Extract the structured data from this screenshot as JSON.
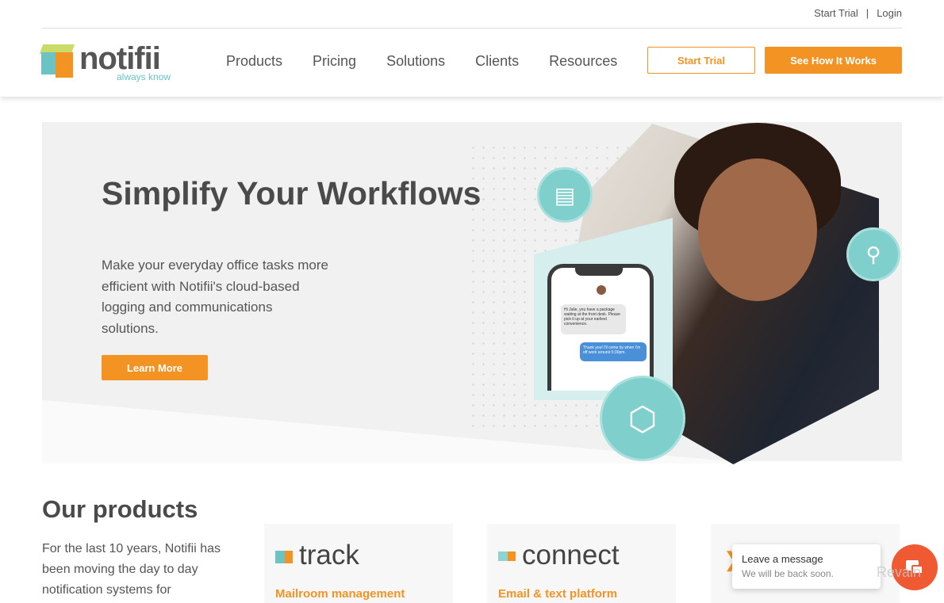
{
  "topbar": {
    "start_trial": "Start Trial",
    "sep": "|",
    "login": "Login"
  },
  "logo": {
    "name": "notifii",
    "tagline": "always know"
  },
  "nav": [
    "Products",
    "Pricing",
    "Solutions",
    "Clients",
    "Resources"
  ],
  "header_buttons": {
    "start_trial": "Start Trial",
    "see_how": "See How It Works"
  },
  "hero": {
    "title": "Simplify Your Workflows",
    "text": "Make your everyday office tasks more efficient with Notifii's cloud-based logging and communications solutions.",
    "cta": "Learn More",
    "phone": {
      "incoming": "Hi Julie, you have a package waiting at the front desk. Please pick it up at your earliest convenience.",
      "reply": "Thank you! I'll come by when I'm off work around 5:30pm."
    }
  },
  "products": {
    "title": "Our products",
    "text": "For the last 10 years, Notifii has been moving the day to day notification systems for",
    "cards": [
      {
        "name": "track",
        "sub": "Mailroom management"
      },
      {
        "name": "connect",
        "sub": "Email & text platform"
      },
      {
        "name": "",
        "sub": ""
      }
    ]
  },
  "chat": {
    "title": "Leave a message",
    "subtitle": "We will be back soon."
  },
  "watermark": "Revain",
  "colors": {
    "accent": "#f39324",
    "teal": "#7fcfcc",
    "chat": "#ef5a32"
  }
}
